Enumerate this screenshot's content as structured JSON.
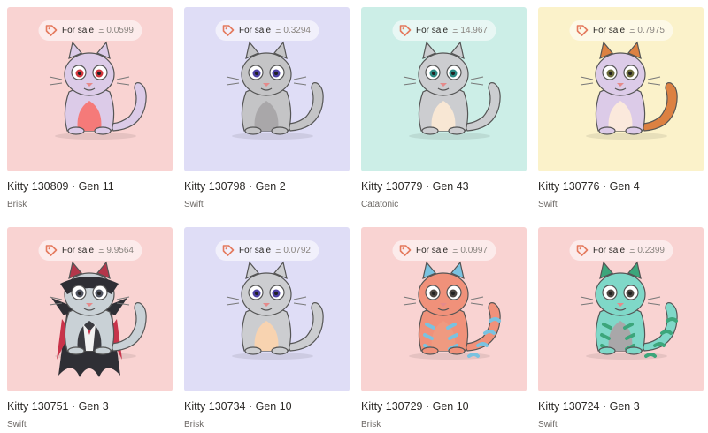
{
  "kitties": [
    {
      "name": "Kitty 130809 · Gen 11",
      "speed": "Brisk",
      "sale_label": "For sale",
      "price": "Ξ 0.0599",
      "bg": "#f9d3d2",
      "body": "#dccbe8",
      "belly": "#f57a79",
      "tail": "#dccbe8",
      "eye": "#d0363c",
      "accent": "#dccbe8",
      "costume": "none"
    },
    {
      "name": "Kitty 130798 · Gen 2",
      "speed": "Swift",
      "sale_label": "For sale",
      "price": "Ξ 0.3294",
      "bg": "#dfddf6",
      "body": "#c4c4c6",
      "belly": "#a9a7a9",
      "tail": "#c4c4c6",
      "eye": "#4b3fa0",
      "accent": "#c4c4c6",
      "costume": "none"
    },
    {
      "name": "Kitty 130779 · Gen 43",
      "speed": "Catatonic",
      "sale_label": "For sale",
      "price": "Ξ 14.967",
      "bg": "#cceee7",
      "body": "#cccdd0",
      "belly": "#f8e7d4",
      "tail": "#cccdd0",
      "eye": "#2c8a83",
      "accent": "#cccdd0",
      "costume": "none"
    },
    {
      "name": "Kitty 130776 · Gen 4",
      "speed": "Swift",
      "sale_label": "For sale",
      "price": "Ξ 0.7975",
      "bg": "#fbf2ca",
      "body": "#dccbe8",
      "belly": "#fbe9dc",
      "tail": "#dc8142",
      "eye": "#6a6a3a",
      "accent": "#dc8142",
      "costume": "none"
    },
    {
      "name": "Kitty 130751 · Gen 3",
      "speed": "Swift",
      "sale_label": "For sale",
      "price": "Ξ 9.9564",
      "bg": "#f9d3d2",
      "body": "#c9d1d6",
      "belly": "#3a3a40",
      "tail": "#c9d1d6",
      "eye": "#4f5360",
      "accent": "#b3364a",
      "costume": "vampire"
    },
    {
      "name": "Kitty 130734 · Gen 10",
      "speed": "Brisk",
      "sale_label": "For sale",
      "price": "Ξ 0.0792",
      "bg": "#dfddf6",
      "body": "#cccdd0",
      "belly": "#f8d3b0",
      "tail": "#cccdd0",
      "eye": "#4b3fa0",
      "accent": "#cccdd0",
      "costume": "none"
    },
    {
      "name": "Kitty 130729 · Gen 10",
      "speed": "Brisk",
      "sale_label": "For sale",
      "price": "Ξ 0.0997",
      "bg": "#f9d3d2",
      "body": "#f0917a",
      "belly": "#ef9a80",
      "tail": "#f0917a",
      "eye": "#4b4540",
      "accent": "#7ac2e0",
      "costume": "stripes"
    },
    {
      "name": "Kitty 130724 · Gen 3",
      "speed": "Swift",
      "sale_label": "For sale",
      "price": "Ξ 0.2399",
      "bg": "#f9d3d2",
      "body": "#7fd8c8",
      "belly": "#a9a7a9",
      "tail": "#7fd8c8",
      "eye": "#4b4540",
      "accent": "#3ca67b",
      "costume": "stripes"
    }
  ]
}
